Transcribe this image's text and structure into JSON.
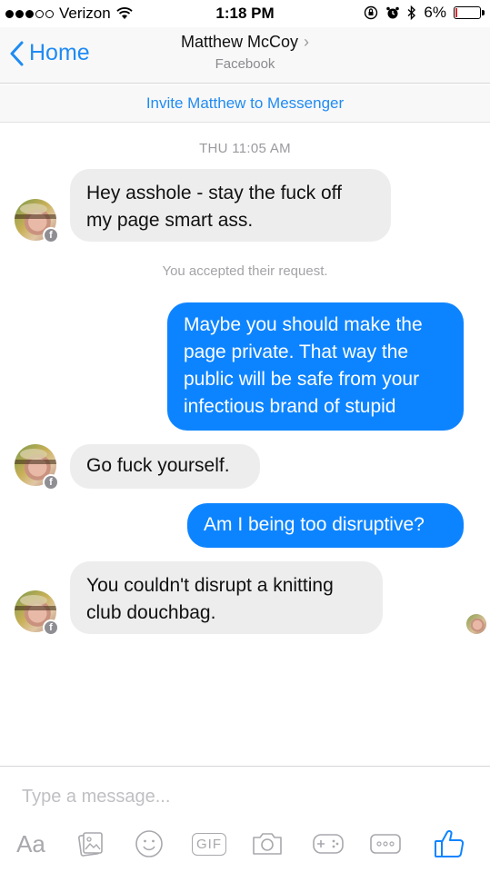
{
  "status_bar": {
    "carrier": "Verizon",
    "time": "1:18 PM",
    "battery": "6%",
    "battery_level": 0.06,
    "signal_bars_filled": 3,
    "signal_bars_total": 5
  },
  "nav": {
    "back_label": "Home",
    "contact_name": "Matthew McCoy",
    "contact_sub": "Facebook"
  },
  "invite_banner": "Invite Matthew to Messenger",
  "conversation": {
    "timestamp": "THU 11:05 AM",
    "system_message": "You accepted their request.",
    "messages": [
      {
        "from": "them",
        "line1": "Hey asshole - stay the fuck off",
        "line2": "my page smart ass."
      },
      {
        "from": "me",
        "line1": "Maybe you should make the",
        "line2": "page private. That way the",
        "line3": "public will be safe from your",
        "line4": "infectious brand of stupid"
      },
      {
        "from": "them",
        "line1": "Go fuck yourself."
      },
      {
        "from": "me",
        "line1": "Am I being too disruptive?"
      },
      {
        "from": "them",
        "line1": "You couldn't disrupt a knitting",
        "line2": "club douchbag."
      }
    ]
  },
  "composer": {
    "placeholder": "Type a message...",
    "aa_label": "Aa",
    "gif_label": "GIF"
  },
  "colors": {
    "accent": "#0d84ff",
    "link": "#1f8bf3",
    "incoming_bubble": "#ededed",
    "battery_low": "#e3262b"
  },
  "icons": [
    "wifi-icon",
    "lock-rotation-icon",
    "alarm-icon",
    "bluetooth-icon",
    "battery-icon",
    "back-chevron-icon",
    "photo-icon",
    "emoji-icon",
    "camera-icon",
    "game-controller-icon",
    "more-icon",
    "like-icon"
  ]
}
